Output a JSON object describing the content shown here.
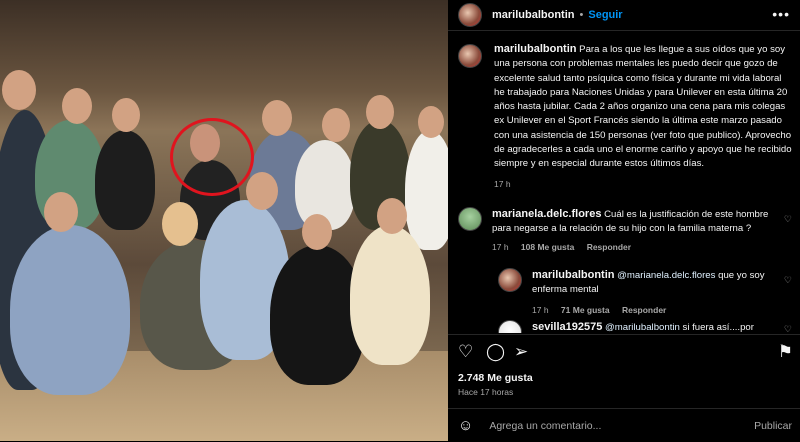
{
  "post": {
    "username": "marilubalbontin",
    "follow_label": "Seguir",
    "more_icon": "more-icon",
    "caption": "Para a los que les llegue a sus oídos que yo soy una persona con problemas mentales les puedo decir que gozo de excelente salud tanto psíquica como física y durante mi vida laboral he trabajado para Naciones Unidas y para Unilever en esta última 20 años hasta jubilar. Cada 2 años organizo una cena para mis colegas ex Unilever en el Sport Francés siendo la última este marzo pasado con una asistencia de 150 personas (ver foto que publico). Aprovecho de agradecerles a cada uno el enorme cariño y apoyo que he recibido siempre y en especial durante estos últimos días.",
    "caption_time": "17 h"
  },
  "comments": [
    {
      "username": "marianela.delc.flores",
      "text": "Cuál es la justificación de este hombre para negarse a la relación de su hijo con la familia materna ?",
      "time": "17 h",
      "likes": "108 Me gusta",
      "reply": "Responder"
    },
    {
      "username": "marilubalbontin",
      "mention": "@marianela.delc.flores",
      "text": "que yo soy enferma mental",
      "time": "17 h",
      "likes": "71 Me gusta",
      "reply": "Responder"
    },
    {
      "username": "sevilla192575",
      "mention": "@marilubalbontin",
      "text": "si fuera así....por"
    }
  ],
  "stats": {
    "likes": "2.748 Me gusta",
    "ago": "Hace 17 horas"
  },
  "composer": {
    "placeholder": "Agrega un comentario...",
    "post_label": "Publicar"
  },
  "icons": [
    "heart-icon",
    "comment-icon",
    "share-icon",
    "bookmark-icon",
    "emoji-icon"
  ],
  "colors": {
    "accent": "#0095f6",
    "highlight_circle": "#e0141e",
    "background": "#000000"
  }
}
